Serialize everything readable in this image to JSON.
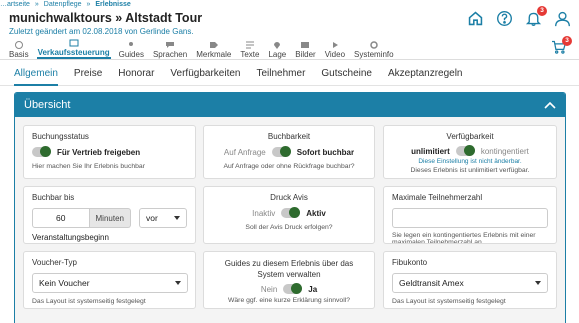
{
  "breadcrumb": [
    "…artseite",
    "»",
    "Datenpflege",
    "»",
    "Erlebnisse"
  ],
  "header": {
    "title": "munichwalktours » Altstadt Tour",
    "subtitle": "Zuletzt geändert am 02.08.2018 von Gerlinde Gans.",
    "notification_count": "3",
    "cart_count": "3",
    "icons": [
      "home-icon",
      "help-icon",
      "bell-icon",
      "user-icon",
      "cart-icon"
    ]
  },
  "main_tabs": [
    "Basis",
    "Verkaufssteuerung",
    "Guides",
    "Sprachen",
    "Merkmale",
    "Texte",
    "Lage",
    "Bilder",
    "Video",
    "Systeminfo"
  ],
  "sub_tabs": [
    "Allgemein",
    "Preise",
    "Honorar",
    "Verfügbarkeiten",
    "Teilnehmer",
    "Gutscheine",
    "Akzeptanzregeln"
  ],
  "panel": {
    "title": "Übersicht"
  },
  "cards": {
    "status": {
      "label": "Buchungsstatus",
      "toggle_on": "Für Vertrieb freigeben",
      "hint": "Hier machen Sie Ihr Erlebnis buchbar"
    },
    "bookability": {
      "label": "Buchbarkeit",
      "off": "Auf Anfrage",
      "on": "Sofort buchbar",
      "hint": "Auf Anfrage oder ohne Rückfrage buchbar?"
    },
    "availability": {
      "label": "Verfügbarkeit",
      "on": "unlimitiert",
      "off": "kontingentiert",
      "note": "Diese Einstellung ist nicht änderbar.",
      "hint": "Dieses Erlebnis ist unlimitiert verfügbar."
    },
    "bookable_until": {
      "label": "Buchbar bis",
      "value": "60",
      "unit": "Minuten",
      "relation": "vor",
      "reference": "Veranstaltungsbeginn"
    },
    "print_avis": {
      "label": "Druck Avis",
      "off": "Inaktiv",
      "on": "Aktiv",
      "hint": "Soll der Avis Druck erfolgen?"
    },
    "max_participants": {
      "label": "Maximale Teilnehmerzahl",
      "value": "",
      "hint": "Sie legen ein kontingentiertes Erlebnis mit einer maximalen Teilnehmerzahl an."
    },
    "voucher": {
      "label": "Voucher-Typ",
      "value": "Kein Voucher",
      "hint": "Das Layout ist systemseitig festgelegt"
    },
    "guides_managed": {
      "label": "Guides zu diesem Erlebnis über das System verwalten",
      "off": "Nein",
      "on": "Ja",
      "hint": "Wäre ggf. eine kurze Erklärung sinnvoll?"
    },
    "account": {
      "label": "Fibukonto",
      "value": "Geldtransit Amex",
      "hint": "Das Layout ist systemseitig festgelegt"
    }
  }
}
